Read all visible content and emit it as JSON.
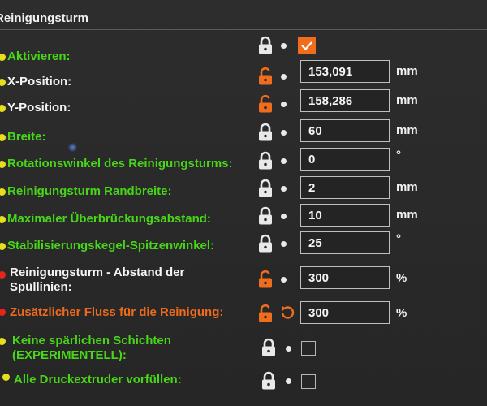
{
  "section": {
    "title": "Reinigungsturm"
  },
  "rows": [
    {
      "label": "Aktivieren:",
      "label_color": "green",
      "dot": "yellow",
      "lock": "locked",
      "type": "checkbox",
      "checked": true
    },
    {
      "label": "X-Position:",
      "label_color": "white",
      "dot": "yellow",
      "lock": "unlocked",
      "type": "field",
      "value": "153,091",
      "unit": "mm"
    },
    {
      "label": "Y-Position:",
      "label_color": "white",
      "dot": "yellow",
      "lock": "unlocked",
      "type": "field",
      "value": "158,286",
      "unit": "mm"
    },
    {
      "label": "Breite:",
      "label_color": "green",
      "dot": "yellow",
      "lock": "locked",
      "type": "field",
      "value": "60",
      "unit": "mm"
    },
    {
      "label": "Rotationswinkel des Reinigungsturms:",
      "label_color": "green",
      "dot": "yellow",
      "lock": "locked",
      "type": "field",
      "value": "0",
      "unit": "°"
    },
    {
      "label": "Reinigungsturm Randbreite:",
      "label_color": "green",
      "dot": "yellow",
      "lock": "locked",
      "type": "field",
      "value": "2",
      "unit": "mm"
    },
    {
      "label": "Maximaler Überbrückungsabstand:",
      "label_color": "green",
      "dot": "yellow",
      "lock": "locked",
      "type": "field",
      "value": "10",
      "unit": "mm"
    },
    {
      "label": "Stabilisierungskegel-Spitzenwinkel:",
      "label_color": "green",
      "dot": "yellow",
      "lock": "locked",
      "type": "field",
      "value": "25",
      "unit": "°"
    },
    {
      "label_line1": "Reinigungsturm - Abstand der",
      "label_line2": "Spüllinien:",
      "label_color": "white",
      "dot": "red",
      "lock": "unlocked",
      "type": "field",
      "value": "300",
      "unit": "%"
    },
    {
      "label": "Zusätzlicher Fluss für die Reinigung:",
      "label_color": "orange",
      "dot": "red",
      "lock": "unlocked",
      "reset": true,
      "type": "field",
      "value": "300",
      "unit": "%"
    },
    {
      "label_line1": "Keine spärlichen Schichten",
      "label_line2": "(EXPERIMENTELL):",
      "label_color": "green",
      "dot": "yellow",
      "lock": "locked",
      "type": "checkbox",
      "checked": false
    },
    {
      "label": "Alle Druckextruder vorfüllen:",
      "label_color": "green",
      "dot": "yellow",
      "lock": "locked",
      "type": "checkbox",
      "checked": false
    }
  ],
  "colors": {
    "accent": "#ef6d1d",
    "green_label": "#48d618",
    "yellow_dot": "#e7de1e",
    "red_dot": "#e32619"
  },
  "icons": {
    "locked": "lock-closed-icon",
    "unlocked": "lock-open-icon",
    "reset": "reset-arrow-icon",
    "bullet": "default-dot-icon"
  }
}
